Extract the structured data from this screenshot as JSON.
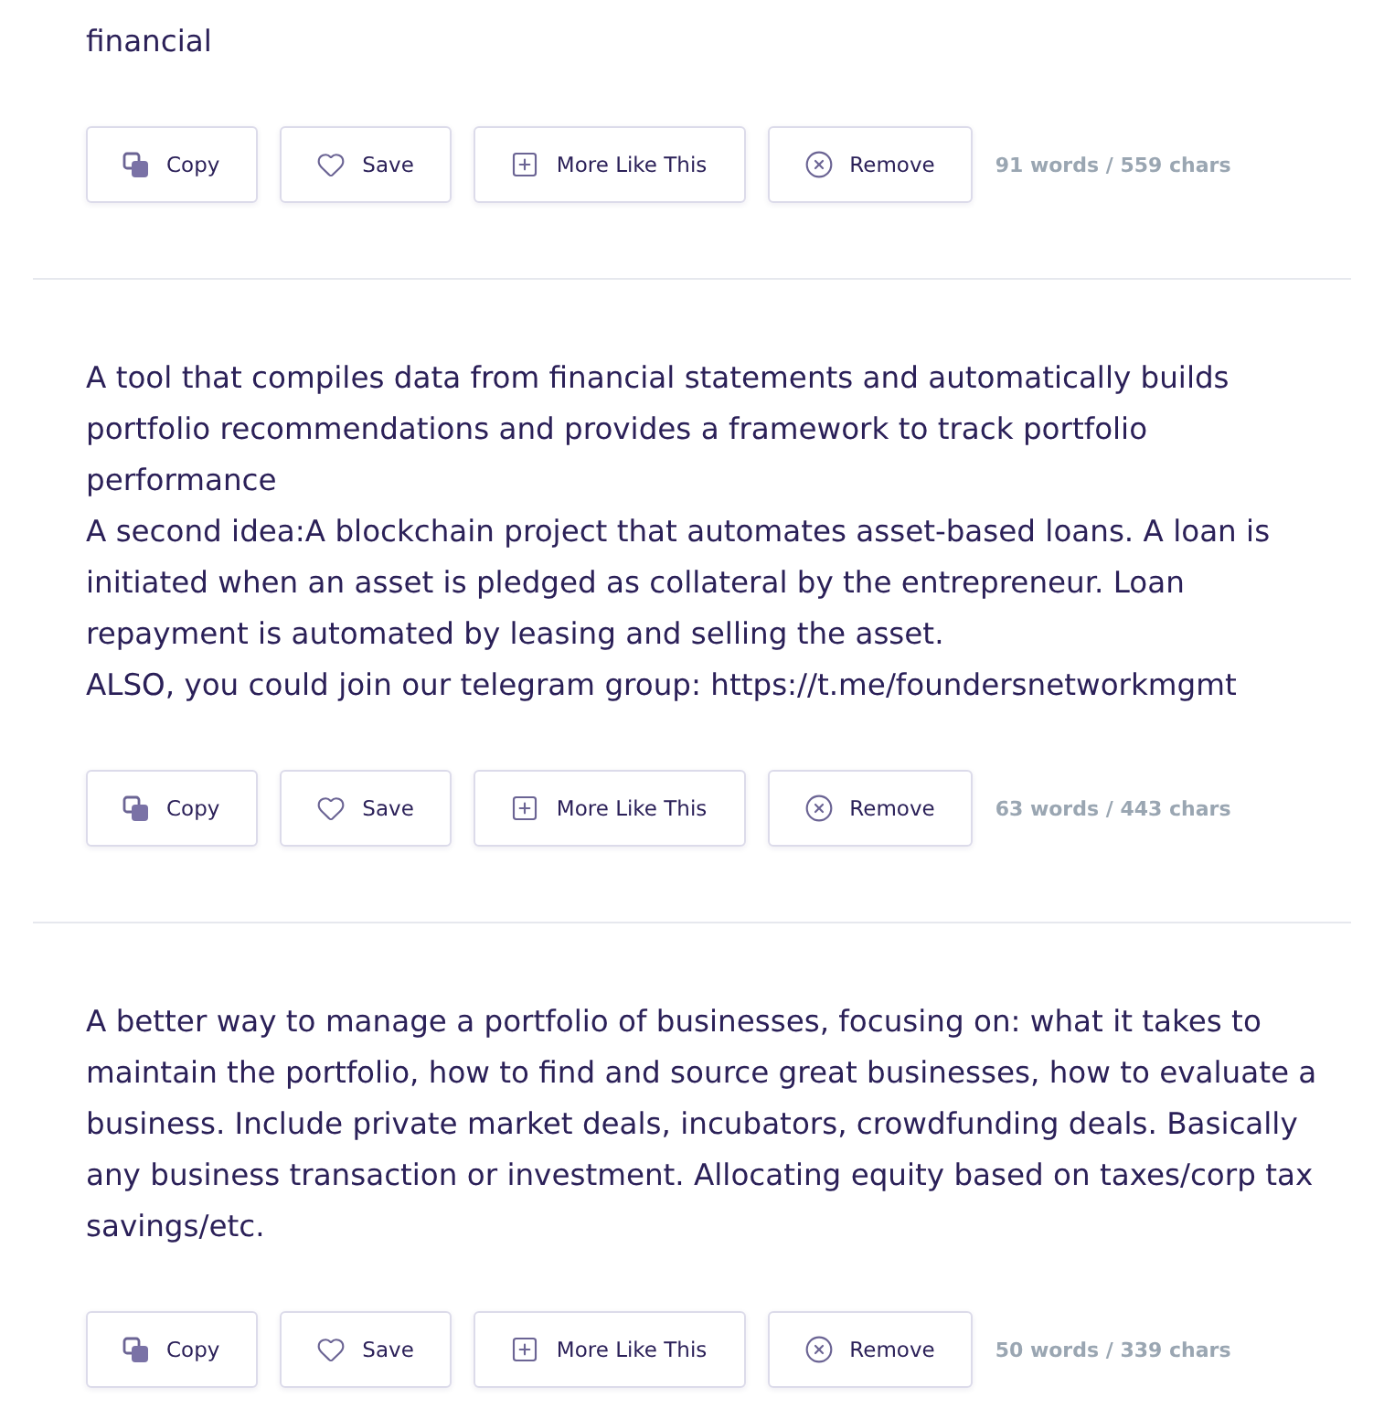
{
  "results": [
    {
      "text": "financial",
      "buttons": [
        {
          "kind": "copy",
          "label": "Copy"
        },
        {
          "kind": "save",
          "label": "Save"
        },
        {
          "kind": "more",
          "label": "More Like This"
        },
        {
          "kind": "remove",
          "label": "Remove"
        }
      ],
      "count": "91 words / 559 chars"
    },
    {
      "text": "A tool that compiles data from financial statements and automatically builds portfolio recommendations and provides a framework to track portfolio performance\nA second idea:A blockchain project that automates asset-based loans. A loan is initiated when an asset is pledged as collateral by the entrepreneur. Loan repayment is automated by leasing and selling the asset.\nALSO, you could join our telegram group: https://t.me/foundersnetworkmgmt",
      "buttons": [
        {
          "kind": "copy",
          "label": "Copy"
        },
        {
          "kind": "save",
          "label": "Save"
        },
        {
          "kind": "more",
          "label": "More Like This"
        },
        {
          "kind": "remove",
          "label": "Remove"
        }
      ],
      "count": "63 words / 443 chars"
    },
    {
      "text": "A better way to manage a portfolio of businesses, focusing on: what it takes to maintain the portfolio, how to find and source great businesses, how to evaluate a business. Include private market deals, incubators, crowdfunding deals. Basically any business transaction or investment. Allocating equity based on taxes/corp tax savings/etc.",
      "buttons": [
        {
          "kind": "copy",
          "label": "Copy"
        },
        {
          "kind": "save",
          "label": "Save"
        },
        {
          "kind": "more",
          "label": "More Like This"
        },
        {
          "kind": "remove",
          "label": "Remove"
        }
      ],
      "count": "50 words / 339 chars"
    }
  ]
}
